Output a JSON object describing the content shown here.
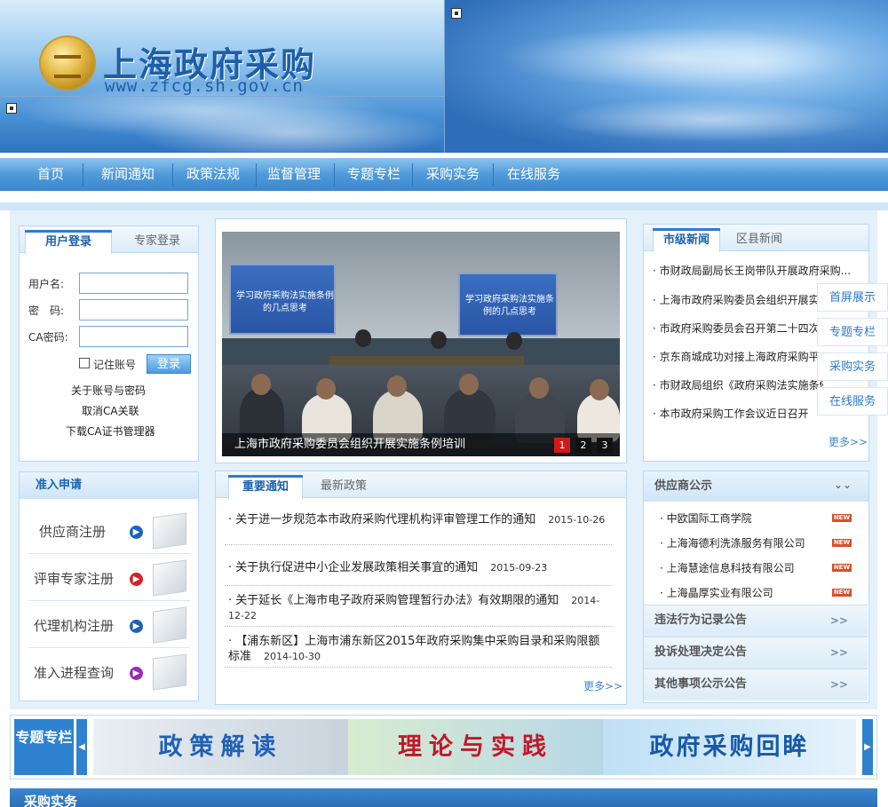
{
  "header": {
    "site_title": "上海政府采购",
    "site_url": "www.zfcg.sh.gov.cn"
  },
  "nav": [
    "首页",
    "新闻通知",
    "政策法规",
    "监督管理",
    "专题专栏",
    "采购实务",
    "在线服务"
  ],
  "login": {
    "tabs": [
      "用户登录",
      "专家登录"
    ],
    "username_label": "用户名:",
    "password_label": "密　码:",
    "ca_label": "CA密码:",
    "remember_label": "记住账号",
    "login_button": "登录",
    "links": [
      "关于账号与密码",
      "取消CA关联",
      "下载CA证书管理器"
    ]
  },
  "registration": {
    "title": "准入申请",
    "items": [
      "供应商注册",
      "评审专家注册",
      "代理机构注册",
      "准入进程查询"
    ]
  },
  "slideshow": {
    "screen_title": "学习政府采购法实施条例的几点思考",
    "caption": "上海市政府采购委员会组织开展实施条例培训",
    "pages": [
      "1",
      "2",
      "3"
    ]
  },
  "notices": {
    "tabs": [
      "重要通知",
      "最新政策"
    ],
    "items": [
      {
        "title": "关于进一步规范本市政府采购代理机构评审管理工作的通知",
        "date": "2015-10-26"
      },
      {
        "title": "关于执行促进中小企业发展政策相关事宜的通知",
        "date": "2015-09-23"
      },
      {
        "title": "关于延长《上海市电子政府采购管理暂行办法》有效期限的通知",
        "date": "2014-12-22"
      },
      {
        "title": "【浦东新区】上海市浦东新区2015年政府采购集中采购目录和采购限额标准",
        "date": "2014-10-30"
      }
    ],
    "more": "更多>>"
  },
  "city_news": {
    "tabs": [
      "市级新闻",
      "区县新闻"
    ],
    "items": [
      "市财政局副局长王岗带队开展政府采购...",
      "上海市政府采购委员会组织开展实施条例培训",
      "市政府采购委员会召开第二十四次会议",
      "京东商城成功对接上海政府采购平台",
      "市财政局组织《政府采购法实施条例》学习",
      "本市政府采购工作会议近日召开"
    ],
    "more": "更多>>"
  },
  "float_menu": [
    "首屏展示",
    "专题专栏",
    "采购实务",
    "在线服务"
  ],
  "supplier": {
    "title": "供应商公示",
    "items": [
      "中欧国际工商学院",
      "上海海德利洗涤服务有限公司",
      "上海慧途信息科技有限公司",
      "上海晶厚实业有限公司"
    ],
    "new_badge": "NEW",
    "public_rows": [
      "违法行为记录公告",
      "投诉处理决定公告",
      "其他事项公示公告"
    ]
  },
  "topics": {
    "label": "专题专栏",
    "banners": [
      "政策解读",
      "理论与实践",
      "政府采购回眸"
    ]
  },
  "bottom_section": "采购实务",
  "colors": {
    "brand_blue": "#2f82cf",
    "title_blue": "#1b61ad",
    "new_red": "#d4502b",
    "active_page": "#d11b1b"
  }
}
